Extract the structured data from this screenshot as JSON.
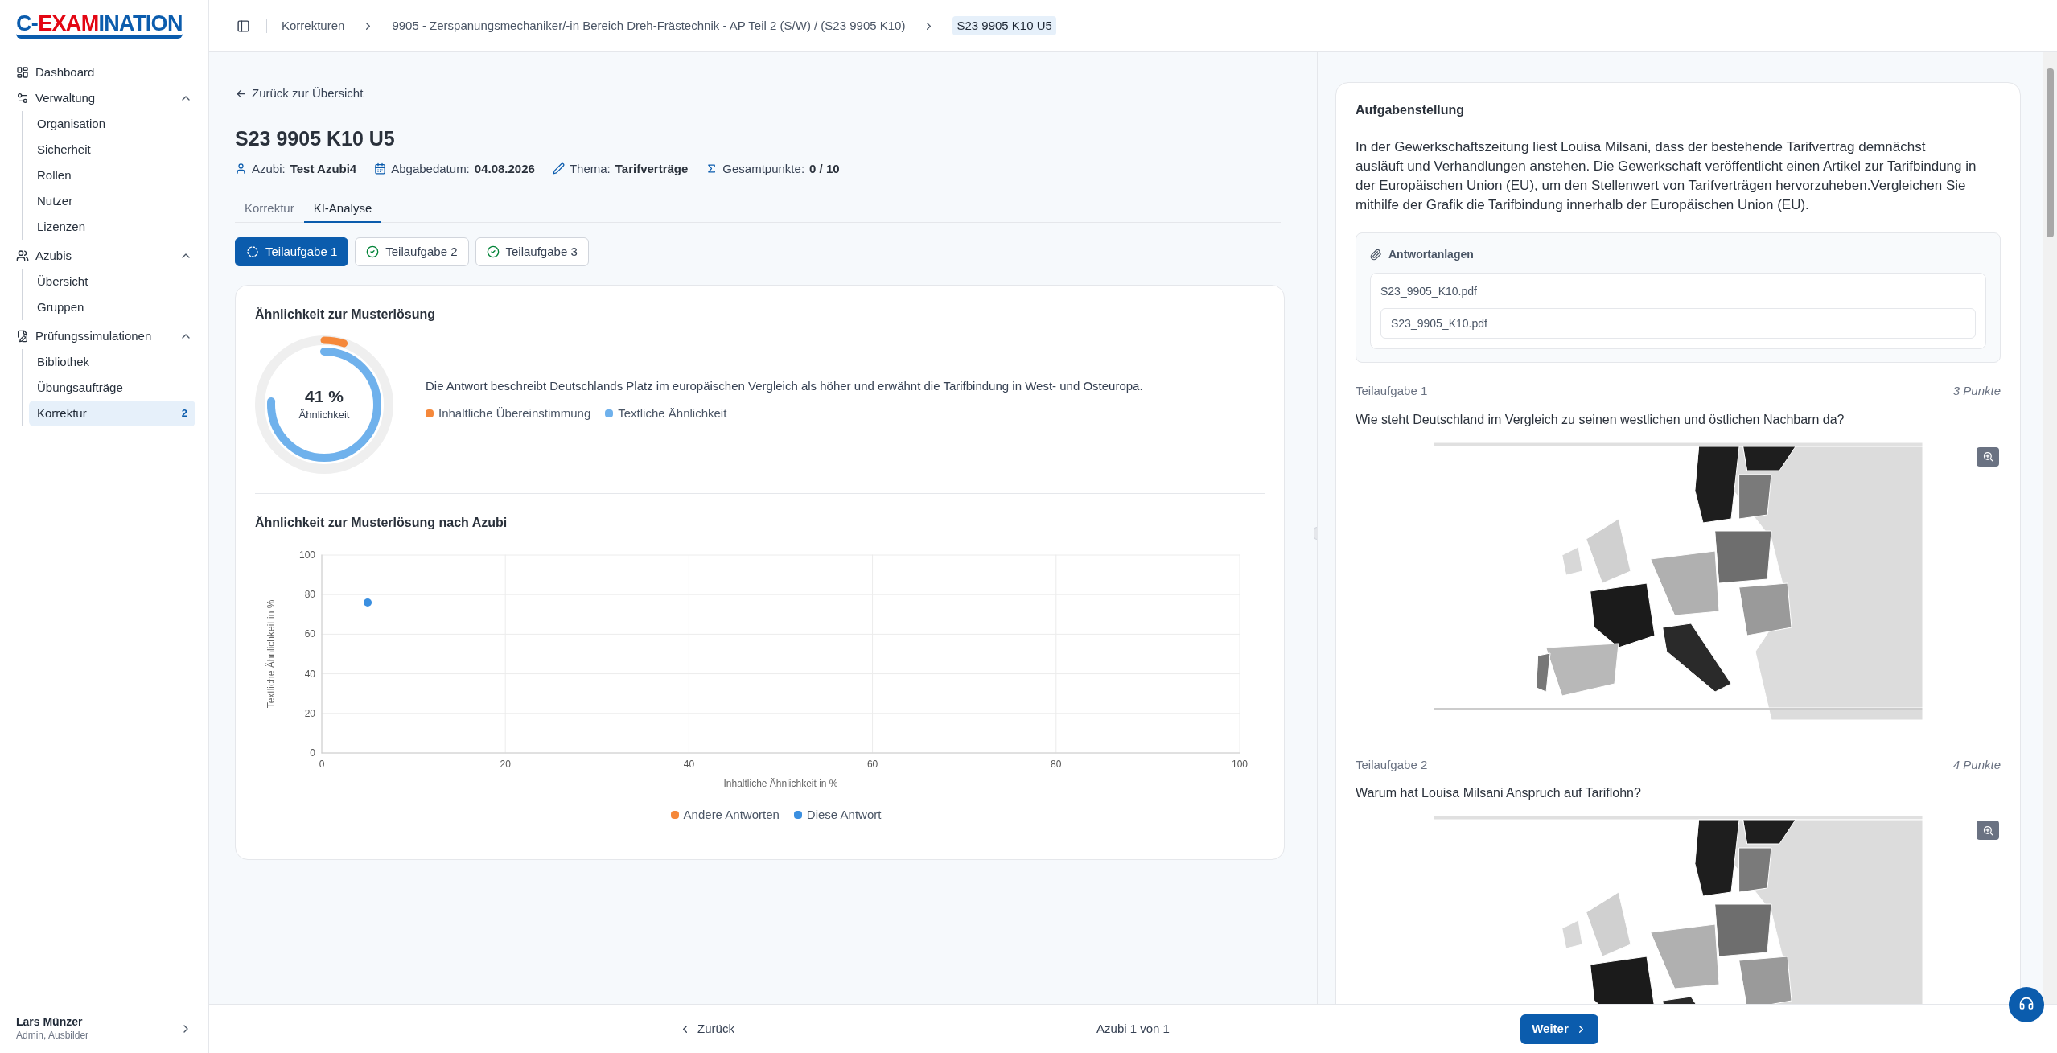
{
  "logo": [
    {
      "text": "C-",
      "color": "#0b5cad"
    },
    {
      "text": "EXAM",
      "color": "#e30613"
    },
    {
      "text": "INATION",
      "color": "#0b5cad"
    }
  ],
  "sidebar": {
    "items": [
      {
        "label": "Dashboard"
      },
      {
        "label": "Verwaltung",
        "expanded": true,
        "children": [
          {
            "label": "Organisation",
            "selected": false
          },
          {
            "label": "Sicherheit",
            "selected": false
          },
          {
            "label": "Rollen",
            "selected": false
          },
          {
            "label": "Nutzer",
            "selected": false
          },
          {
            "label": "Lizenzen",
            "selected": false
          }
        ]
      },
      {
        "label": "Azubis",
        "expanded": true,
        "children": [
          {
            "label": "Übersicht",
            "selected": false
          },
          {
            "label": "Gruppen",
            "selected": false
          }
        ]
      },
      {
        "label": "Prüfungssimulationen",
        "expanded": true,
        "children": [
          {
            "label": "Bibliothek",
            "selected": false
          },
          {
            "label": "Übungsaufträge",
            "selected": false
          },
          {
            "label": "Korrektur",
            "selected": true,
            "badge": "2"
          }
        ]
      }
    ]
  },
  "user": {
    "name": "Lars Münzer",
    "role": "Admin, Ausbilder"
  },
  "breadcrumbs": [
    {
      "label": "Korrekturen",
      "selected": false
    },
    {
      "label": "9905 - Zerspanungsmechaniker/-in Bereich Dreh-Frästechnik - AP Teil 2 (S/W) / (S23 9905 K10)",
      "selected": false
    },
    {
      "label": "S23 9905 K10 U5",
      "selected": true
    }
  ],
  "back_link": "Zurück zur Übersicht",
  "title": "S23 9905 K10 U5",
  "meta": [
    {
      "label": "Azubi:",
      "value": "Test Azubi4"
    },
    {
      "label": "Abgabedatum:",
      "value": "04.08.2026"
    },
    {
      "label": "Thema:",
      "value": "Tarifverträge"
    },
    {
      "label": "Gesamtpunkte:",
      "value": "0 / 10"
    }
  ],
  "tabs": [
    {
      "label": "Korrektur",
      "selected": false
    },
    {
      "label": "KI-Analyse",
      "selected": true
    }
  ],
  "subtasks": [
    {
      "label": "Teilaufgabe 1",
      "selected": true,
      "done": false
    },
    {
      "label": "Teilaufgabe 2",
      "selected": false,
      "done": true
    },
    {
      "label": "Teilaufgabe 3",
      "selected": false,
      "done": true
    }
  ],
  "similarity": {
    "title": "Ähnlichkeit zur Musterlösung",
    "value": "41 %",
    "caption": "Ähnlichkeit",
    "summary": "Die Antwort beschreibt Deutschlands Platz im europäischen Vergleich als höher und erwähnt die Tarifbindung in West- und Osteuropa.",
    "legend": [
      {
        "label": "Inhaltliche Übereinstimmung",
        "color": "#f5883a",
        "level": 0.05
      },
      {
        "label": "Textliche Ähnlichkeit",
        "color": "#6fb1ec",
        "level": 0.76
      }
    ]
  },
  "scatter": {
    "title": "Ähnlichkeit zur Musterlösung nach Azubi",
    "chart_data": {
      "type": "scatter",
      "grid": true,
      "xlabel": "Inhaltliche Ähnlichkeit in %",
      "ylabel": "Textliche Ähnlichkeit in %",
      "x": [
        5
      ],
      "xlim": [
        0,
        100
      ],
      "ylim": [
        0,
        100
      ],
      "xticks": [
        0,
        20,
        40,
        60,
        80,
        100
      ],
      "yticks": [
        0,
        20,
        40,
        60,
        80,
        100
      ],
      "series": [
        {
          "name": "Andere Antworten",
          "color": "#f5883a",
          "values": [
            null
          ]
        },
        {
          "name": "Diese Antwort",
          "color": "#3b8fe0",
          "values": [
            76
          ]
        }
      ]
    }
  },
  "task": {
    "title": "Aufgabenstellung",
    "text": "In der Gewerkschaftszeitung liest Louisa Milsani, dass der bestehende Tarifvertrag demnächst ausläuft und Verhandlungen anstehen. Die Gewerkschaft veröffentlicht einen Artikel zur Tarifbindung in der Europäischen Union (EU), um den Stellenwert von Tarifverträgen hervorzuheben.Vergleichen Sie mithilfe der Grafik die Tarifbindung innerhalb der Europäischen Union (EU).",
    "attachments": {
      "title": "Antwortanlagen",
      "files": [
        {
          "name": "S23_9905_K10.pdf",
          "field": "S23_9905_K10.pdf"
        }
      ]
    },
    "questions": [
      {
        "label": "Teilaufgabe 1",
        "points": "3 Punkte",
        "question": "Wie steht Deutschland im Vergleich zu seinen westlichen und östlichen Nachbarn da?",
        "kind": "picture"
      },
      {
        "label": "Teilaufgabe 2",
        "points": "4 Punkte",
        "question": "Warum hat Louisa Milsani Anspruch auf Tariflohn?",
        "kind": "picture"
      }
    ]
  },
  "footer": {
    "back": "Zurück",
    "counter": "Azubi 1 von 1",
    "next": "Weiter"
  }
}
